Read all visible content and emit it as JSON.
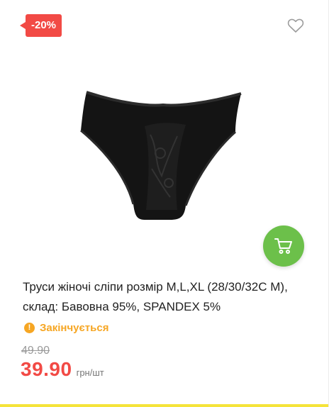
{
  "product": {
    "discount_badge": "-20%",
    "title": "Труси жіночі сліпи розмір M,L,XL (28/30/32C M), склад: Бавовна 95%, SPANDEX 5%",
    "stock_status": "Закінчується",
    "old_price": "49.90",
    "price": "39.90",
    "price_unit": "грн/шт"
  },
  "icons": {
    "favorite": "heart-outline-icon",
    "cart": "shopping-cart-icon",
    "stock_warning": "exclamation-circle-icon"
  },
  "colors": {
    "discount": "#f24a45",
    "cart_button": "#6cc04a",
    "stock_warning": "#f6a623",
    "price": "#f24a45"
  }
}
